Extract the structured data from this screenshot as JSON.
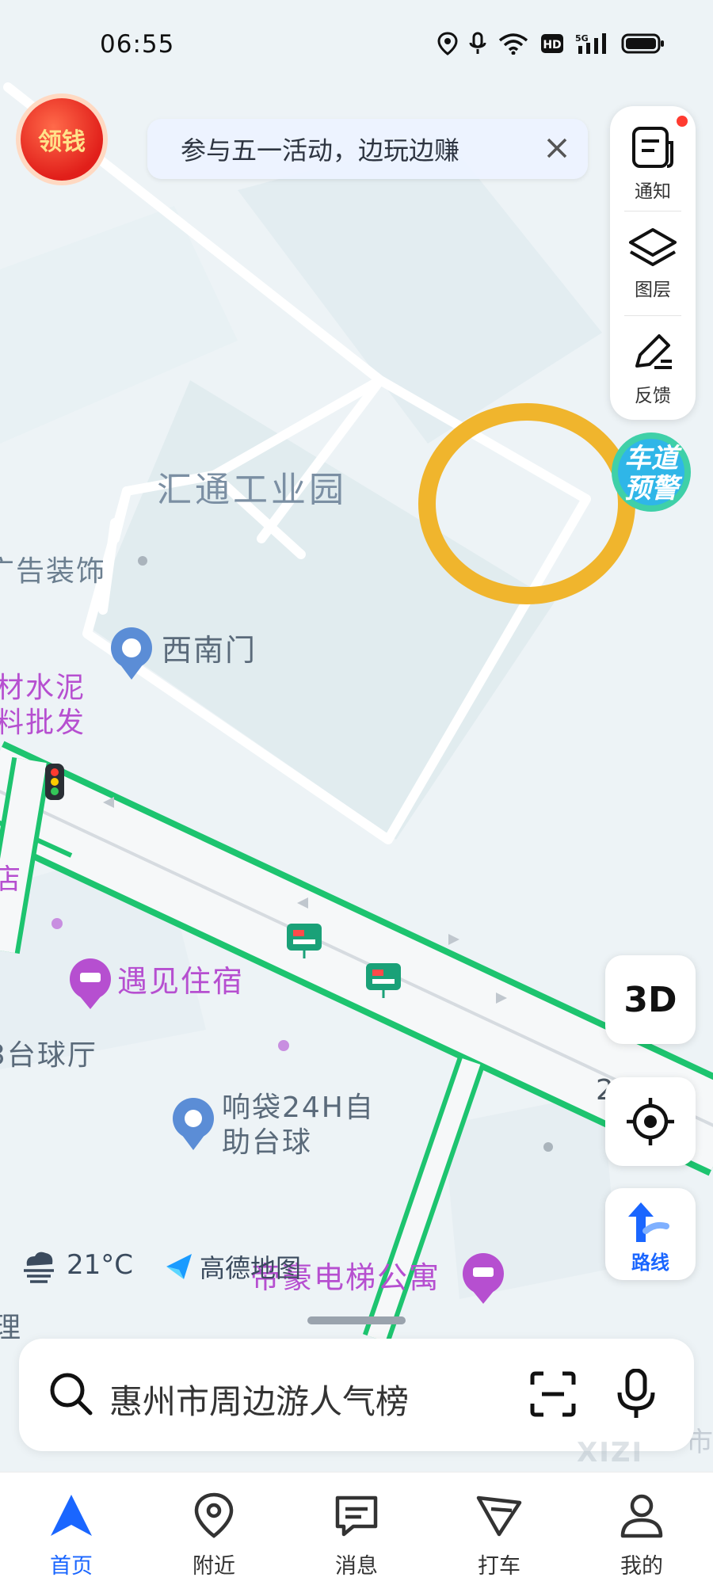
{
  "status_bar": {
    "time": "06:55"
  },
  "promo": {
    "text": "参与五一活动，边玩边赚",
    "badge": "领钱"
  },
  "right_panel": {
    "notice_label": "通知",
    "layers_label": "图层",
    "feedback_label": "反馈"
  },
  "lane_warning": {
    "text": "车道预警"
  },
  "map": {
    "industrial_park": "汇通工业园",
    "decor": "广告装饰",
    "southwest_gate": "西南门",
    "cement_line1": "材水泥",
    "cement_line2": "料批发",
    "shop_fragment": "店",
    "hotel": "遇见住宿",
    "billiard_fragment": "3台球厅",
    "xiangdai_line1": "响袋24H自",
    "xiangdai_line2": "助台球",
    "apartment": "帝豪电梯公寓",
    "road_number": "2",
    "left_edge_fragment": "理",
    "right_edge_fragment": "市"
  },
  "controls": {
    "mode_3d": "3D",
    "route_label": "路线"
  },
  "weather": {
    "temperature": "21°C"
  },
  "brand": {
    "name": "高德地图"
  },
  "search": {
    "placeholder": "惠州市周边游人气榜"
  },
  "tabs": [
    {
      "label": "首页",
      "active": true
    },
    {
      "label": "附近"
    },
    {
      "label": "消息"
    },
    {
      "label": "打车"
    },
    {
      "label": "我的"
    }
  ],
  "watermark": "XIZI",
  "colors": {
    "accent": "#1a66ff",
    "road_green": "#1dc46f",
    "poi_purple": "#b64fd0",
    "highlight_ring": "#f0b52d"
  }
}
